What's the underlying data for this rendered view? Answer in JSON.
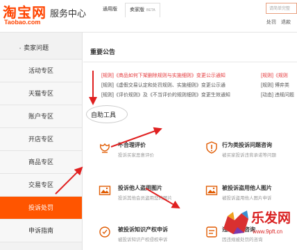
{
  "header": {
    "logo_cn": "淘宝网",
    "logo_en": "Taobao.com",
    "site_title": "服务中心",
    "tabs": [
      {
        "label": "通用版"
      },
      {
        "label": "卖家版",
        "badge": "BETA"
      }
    ],
    "search_placeholder": "请简单完整",
    "links": [
      "处罚",
      "退款"
    ]
  },
  "sidebar": {
    "heading": "卖家问题",
    "items": [
      {
        "label": "活动专区"
      },
      {
        "label": "天猫专区"
      },
      {
        "label": "账户专区"
      },
      {
        "label": "开店专区"
      },
      {
        "label": "商品专区"
      },
      {
        "label": "交易专区"
      },
      {
        "label": "投诉处罚"
      },
      {
        "label": "申诉指南"
      }
    ],
    "active_index": 6
  },
  "main": {
    "section_title": "重要公告",
    "notices_left": [
      {
        "text": "[规则]《商品如何下架删除规则与实施细则》变更公示通知",
        "color": "red"
      },
      {
        "text": "[规则]《虚假交易认定和处罚规则、实施细则》变更公示通",
        "color": "gray"
      },
      {
        "text": "[规则]《评价规则》及《不当评价的规则细则》变更生效通知",
        "color": "gray"
      }
    ],
    "notices_right": [
      {
        "text": "[规则]《规则",
        "color": "red"
      },
      {
        "text": "[规则] 博弈类",
        "color": "gray"
      },
      {
        "text": "[动态] 违规问题",
        "color": "gray"
      }
    ],
    "tools_title": "自助工具",
    "tools": [
      {
        "title": "不合理评价",
        "desc": "投诉买家恶意评价",
        "icon": "flower-icon"
      },
      {
        "title": "行为类投诉问题咨询",
        "desc": "被买家投诉违背承诺等问题",
        "icon": "warning-icon"
      },
      {
        "title": "投诉他人盗用图片",
        "desc": "投诉其他会员盗用您的图片",
        "icon": "image-icon"
      },
      {
        "title": "被投诉盗用他人图片",
        "desc": "被投诉盗用他人图片申诉",
        "icon": "image-icon"
      },
      {
        "title": "被投诉知识产权申诉",
        "desc": "被投诉知识产权侵权申诉",
        "icon": "ip-icon"
      },
      {
        "title": "违规处罚咨询",
        "desc": "因违规被处罚的咨询",
        "icon": "badge-icon"
      }
    ]
  },
  "watermark": {
    "brand": "乐发网",
    "url": "www.9pft.cn"
  },
  "colors": {
    "accent": "#ff5500",
    "brand": "#ff4400",
    "notice_red": "#e4393c",
    "annotation": "#e02020"
  }
}
